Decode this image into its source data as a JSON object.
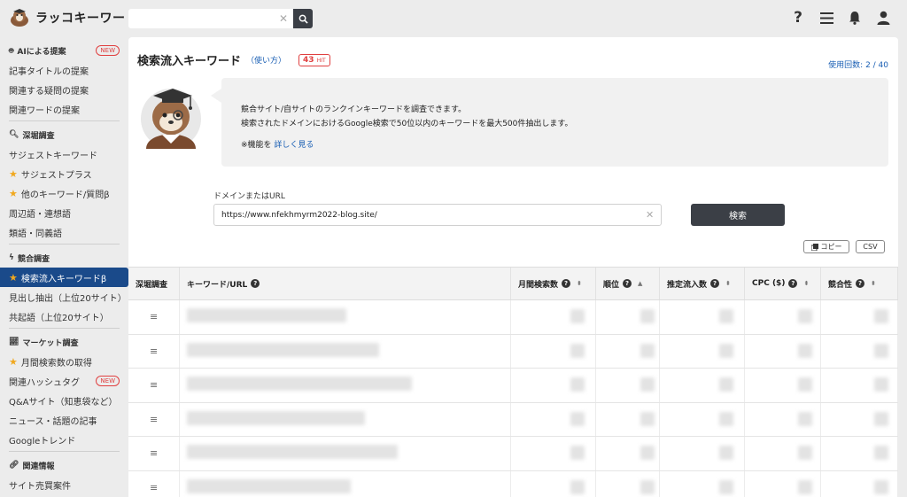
{
  "app": {
    "name": "ラッコキーワード"
  },
  "header": {
    "search_placeholder": ""
  },
  "sidebar": {
    "sections": [
      {
        "title": "AIによる提案",
        "badge": "NEW",
        "items": [
          "記事タイトルの提案",
          "関連する疑問の提案",
          "関連ワードの提案"
        ]
      },
      {
        "title": "深堀調査",
        "items": [
          "サジェストキーワード",
          "サジェストプラス",
          "他のキーワード/質問β",
          "周辺語・連想語",
          "類語・同義語"
        ]
      },
      {
        "title": "競合調査",
        "items": [
          "検索流入キーワードβ",
          "見出し抽出（上位20サイト）",
          "共起語（上位20サイト）"
        ]
      },
      {
        "title": "マーケット調査",
        "items": [
          "月間検索数の取得",
          "関連ハッシュタグ",
          "Q&Aサイト（知恵袋など）",
          "ニュース・話題の記事",
          "Googleトレンド"
        ],
        "item_badge": "NEW"
      },
      {
        "title": "関連情報",
        "items": [
          "サイト売買案件"
        ]
      }
    ]
  },
  "main": {
    "title": "検索流入キーワード",
    "howto": "（使い方）",
    "hit_count": "43",
    "hit_unit": "HIT",
    "usage": "使用回数: 2 / 40",
    "info": {
      "line1": "競合サイト/自サイトのランクインキーワードを調査できます。",
      "line2": "検索されたドメインにおけるGoogle検索で50位以内のキーワードを最大500件抽出します。",
      "line3_prefix": "※機能を ",
      "line3_link": "詳しく見る"
    },
    "domain_label": "ドメインまたはURL",
    "domain_value": "https://www.nfekhmyrm2022-blog.site/",
    "search_button": "検索",
    "copy_button": "コピー",
    "csv_button": "CSV"
  },
  "table": {
    "columns": [
      "深堀調査",
      "キーワード/URL",
      "月間検索数",
      "順位",
      "推定流入数",
      "CPC ($)",
      "競合性"
    ]
  },
  "colors": {
    "accent": "#1a4a8a",
    "link": "#1a5fb4",
    "badge": "#e04040",
    "star": "#f0a81f",
    "button": "#3b3f46"
  }
}
